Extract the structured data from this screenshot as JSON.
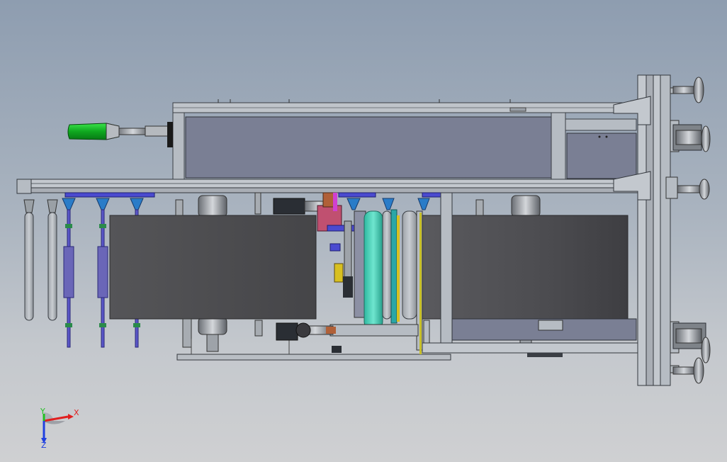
{
  "viewport": {
    "background_top": "#8e9db0",
    "background_bottom": "#cfd0d2"
  },
  "triad": {
    "x_label": "X",
    "y_label": "Y",
    "z_label": "Z",
    "x_color": "#e02020",
    "y_color": "#20c020",
    "z_color": "#2040e0"
  },
  "model": {
    "frame_color": "#b6bcc3",
    "belt_color": "#4e4e52",
    "grip_color": "#12b524",
    "tube_color": "#3fcfb6",
    "guide_color": "#5a56c8"
  }
}
